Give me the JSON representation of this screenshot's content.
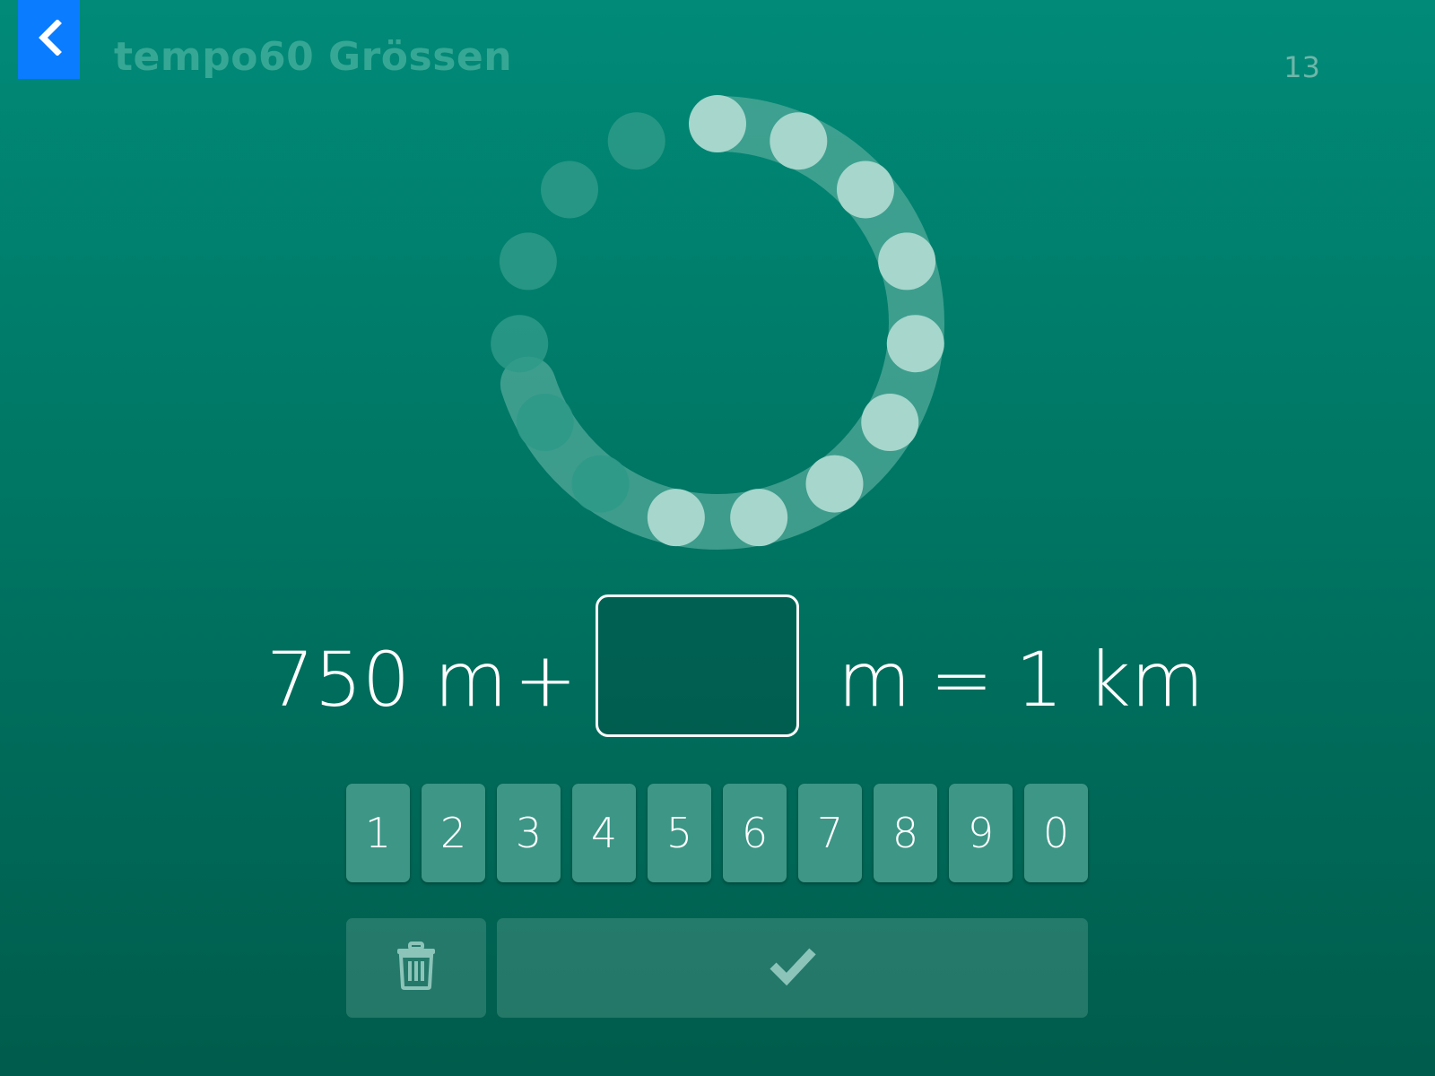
{
  "header": {
    "title": "tempo60 Grössen",
    "question_counter": "13",
    "back_icon": "chevron-left-icon"
  },
  "progress": {
    "total_dots": 15,
    "filled_dots": 9,
    "fraction": 0.6
  },
  "equation": {
    "left_operand": "750 m",
    "operator": "+",
    "answer_value": "",
    "answer_unit": "m",
    "equals": "=",
    "result": "1 km"
  },
  "keypad": {
    "keys": [
      "1",
      "2",
      "3",
      "4",
      "5",
      "6",
      "7",
      "8",
      "9",
      "0"
    ]
  },
  "actions": {
    "delete_icon": "trash-icon",
    "submit_icon": "checkmark-icon"
  },
  "colors": {
    "background_top": "#018a78",
    "background_bottom": "#005c4c",
    "back_button": "#0a7cff",
    "dot_filled": "#a6d6cc",
    "dot_empty": "#2e9a88"
  }
}
